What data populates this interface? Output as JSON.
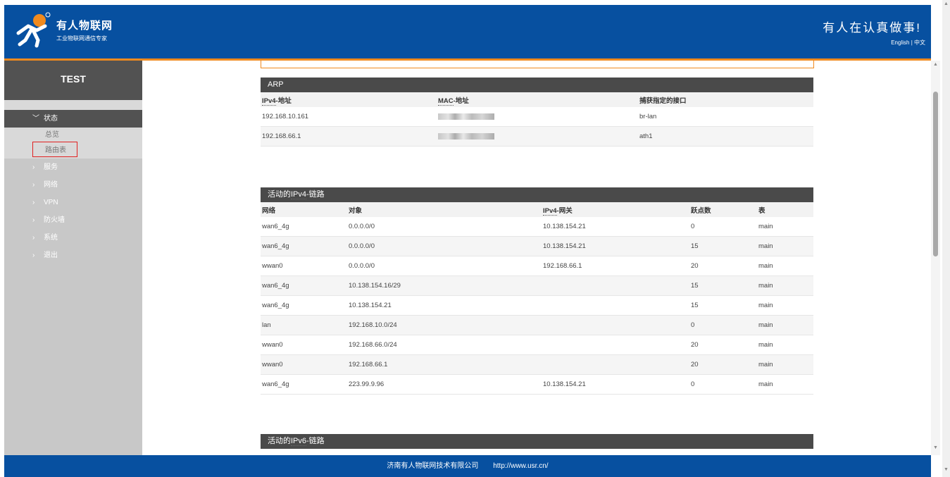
{
  "header": {
    "brand_title": "有人物联网",
    "brand_sub": "工业物联网通信专家",
    "slogan": "有人在认真做事!",
    "lang_en": "English",
    "lang_sep": "|",
    "lang_zh": "中文",
    "accent_color": "#f08a1e",
    "bg_color": "#0750a0"
  },
  "sidebar": {
    "title": "TEST",
    "items": [
      {
        "label": "状态",
        "expanded": true
      },
      {
        "label": "服务"
      },
      {
        "label": "网络"
      },
      {
        "label": "VPN"
      },
      {
        "label": "防火墙"
      },
      {
        "label": "系统"
      },
      {
        "label": "退出"
      }
    ],
    "sub_items": [
      {
        "label": "总览"
      },
      {
        "label": "路由表"
      }
    ]
  },
  "arp": {
    "title": "ARP",
    "headers": {
      "ip_pre": "IPv4",
      "ip_post": "-地址",
      "mac_pre": "MAC",
      "mac_post": "-地址",
      "iface": "捕获指定的接口"
    },
    "rows": [
      {
        "ip": "192.168.10.161",
        "iface": "br-lan"
      },
      {
        "ip": "192.168.66.1",
        "iface": "ath1"
      }
    ]
  },
  "ipv4": {
    "title_pre": "活动的",
    "title_abbr": "IPv4",
    "title_post": "-链路",
    "headers": {
      "net": "网络",
      "target": "对象",
      "gw_pre": "IPv4",
      "gw_post": "-网关",
      "metric": "跃点数",
      "table": "表"
    },
    "rows": [
      {
        "net": "wan6_4g",
        "target": "0.0.0.0/0",
        "gw": "10.138.154.21",
        "metric": "0",
        "table": "main"
      },
      {
        "net": "wan6_4g",
        "target": "0.0.0.0/0",
        "gw": "10.138.154.21",
        "metric": "15",
        "table": "main"
      },
      {
        "net": "wwan0",
        "target": "0.0.0.0/0",
        "gw": "192.168.66.1",
        "metric": "20",
        "table": "main"
      },
      {
        "net": "wan6_4g",
        "target": "10.138.154.16/29",
        "gw": "",
        "metric": "15",
        "table": "main"
      },
      {
        "net": "wan6_4g",
        "target": "10.138.154.21",
        "gw": "",
        "metric": "15",
        "table": "main"
      },
      {
        "net": "lan",
        "target": "192.168.10.0/24",
        "gw": "",
        "metric": "0",
        "table": "main"
      },
      {
        "net": "wwan0",
        "target": "192.168.66.0/24",
        "gw": "",
        "metric": "20",
        "table": "main"
      },
      {
        "net": "wwan0",
        "target": "192.168.66.1",
        "gw": "",
        "metric": "20",
        "table": "main"
      },
      {
        "net": "wan6_4g",
        "target": "223.99.9.96",
        "gw": "10.138.154.21",
        "metric": "0",
        "table": "main"
      }
    ]
  },
  "ipv6": {
    "title_pre": "活动的",
    "title_abbr": "IPv6",
    "title_post": "-链路"
  },
  "footer": {
    "company": "济南有人物联网技术有限公司",
    "url": "http://www.usr.cn/"
  }
}
